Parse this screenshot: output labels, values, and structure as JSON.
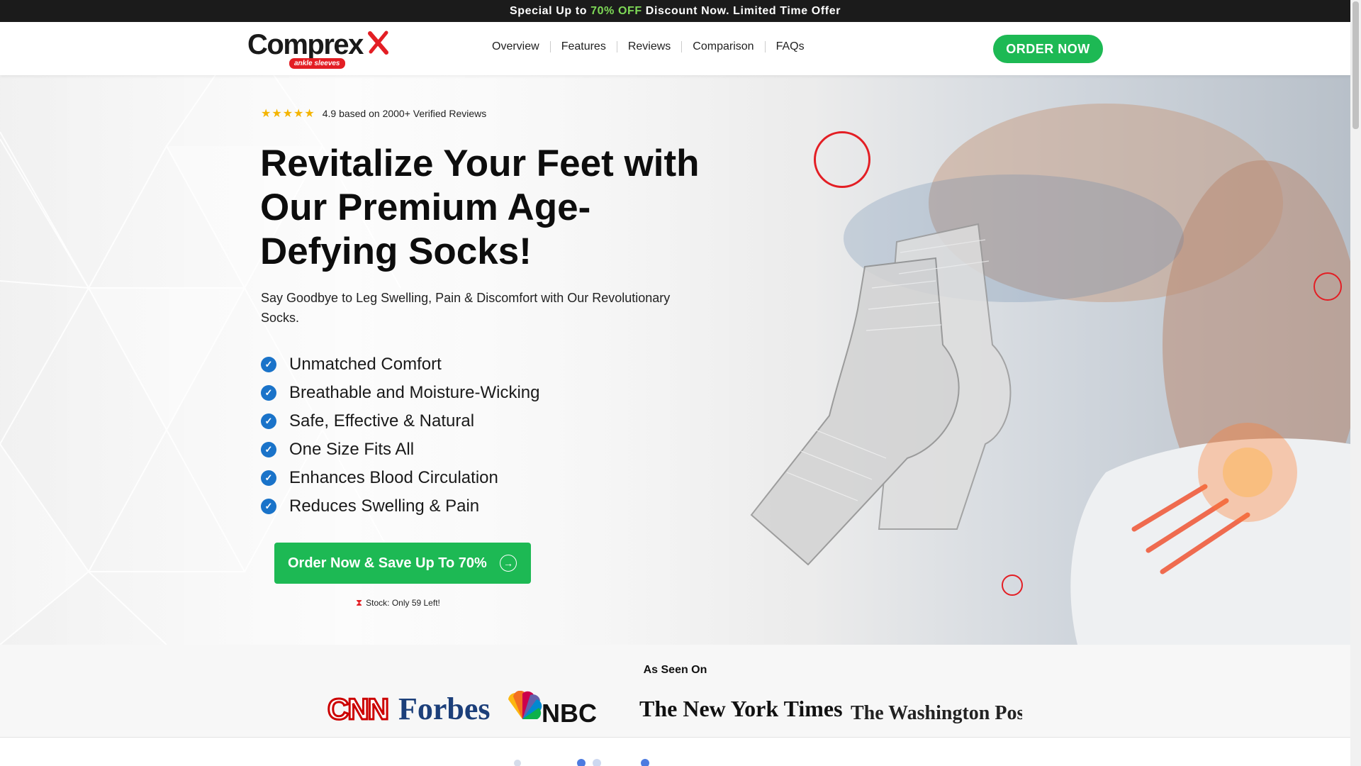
{
  "promo": {
    "prefix": "Special Up to",
    "accent": "70% OFF",
    "suffix": "Discount Now. Limited Time Offer"
  },
  "header": {
    "logo": {
      "word": "Comprex",
      "sub": "ankle sleeves"
    },
    "nav": [
      "Overview",
      "Features",
      "Reviews",
      "Comparison",
      "FAQs"
    ],
    "order_button": "ORDER NOW"
  },
  "hero": {
    "stars": "★★★★★",
    "rating_value": 4.9,
    "rating_text": "4.9 based on 2000+ Verified Reviews",
    "title": "Revitalize Your Feet with Our Premium Age-Defying Socks!",
    "subtitle": "Say Goodbye to Leg Swelling, Pain & Discomfort with Our Revolutionary Socks.",
    "features": [
      "Unmatched Comfort",
      "Breathable and Moisture-Wicking",
      "Safe, Effective & Natural",
      "One Size Fits All",
      "Enhances Blood Circulation",
      "Reduces Swelling & Pain"
    ],
    "cta": "Order Now & Save Up To 70%",
    "stock": "Stock: Only 59 Left!"
  },
  "seen_on": {
    "title": "As Seen On",
    "logos": [
      "CNN",
      "Forbes",
      "NBC",
      "The New York Times",
      "The Washington Post"
    ]
  },
  "colors": {
    "accent_green": "#1db954",
    "promo_green": "#7ed957",
    "check_blue": "#1a73c9",
    "red": "#e31e24"
  },
  "icons": {
    "check": "check-circle-icon",
    "arrow": "arrow-right-icon",
    "hourglass": "hourglass-icon",
    "star": "star-icon"
  }
}
